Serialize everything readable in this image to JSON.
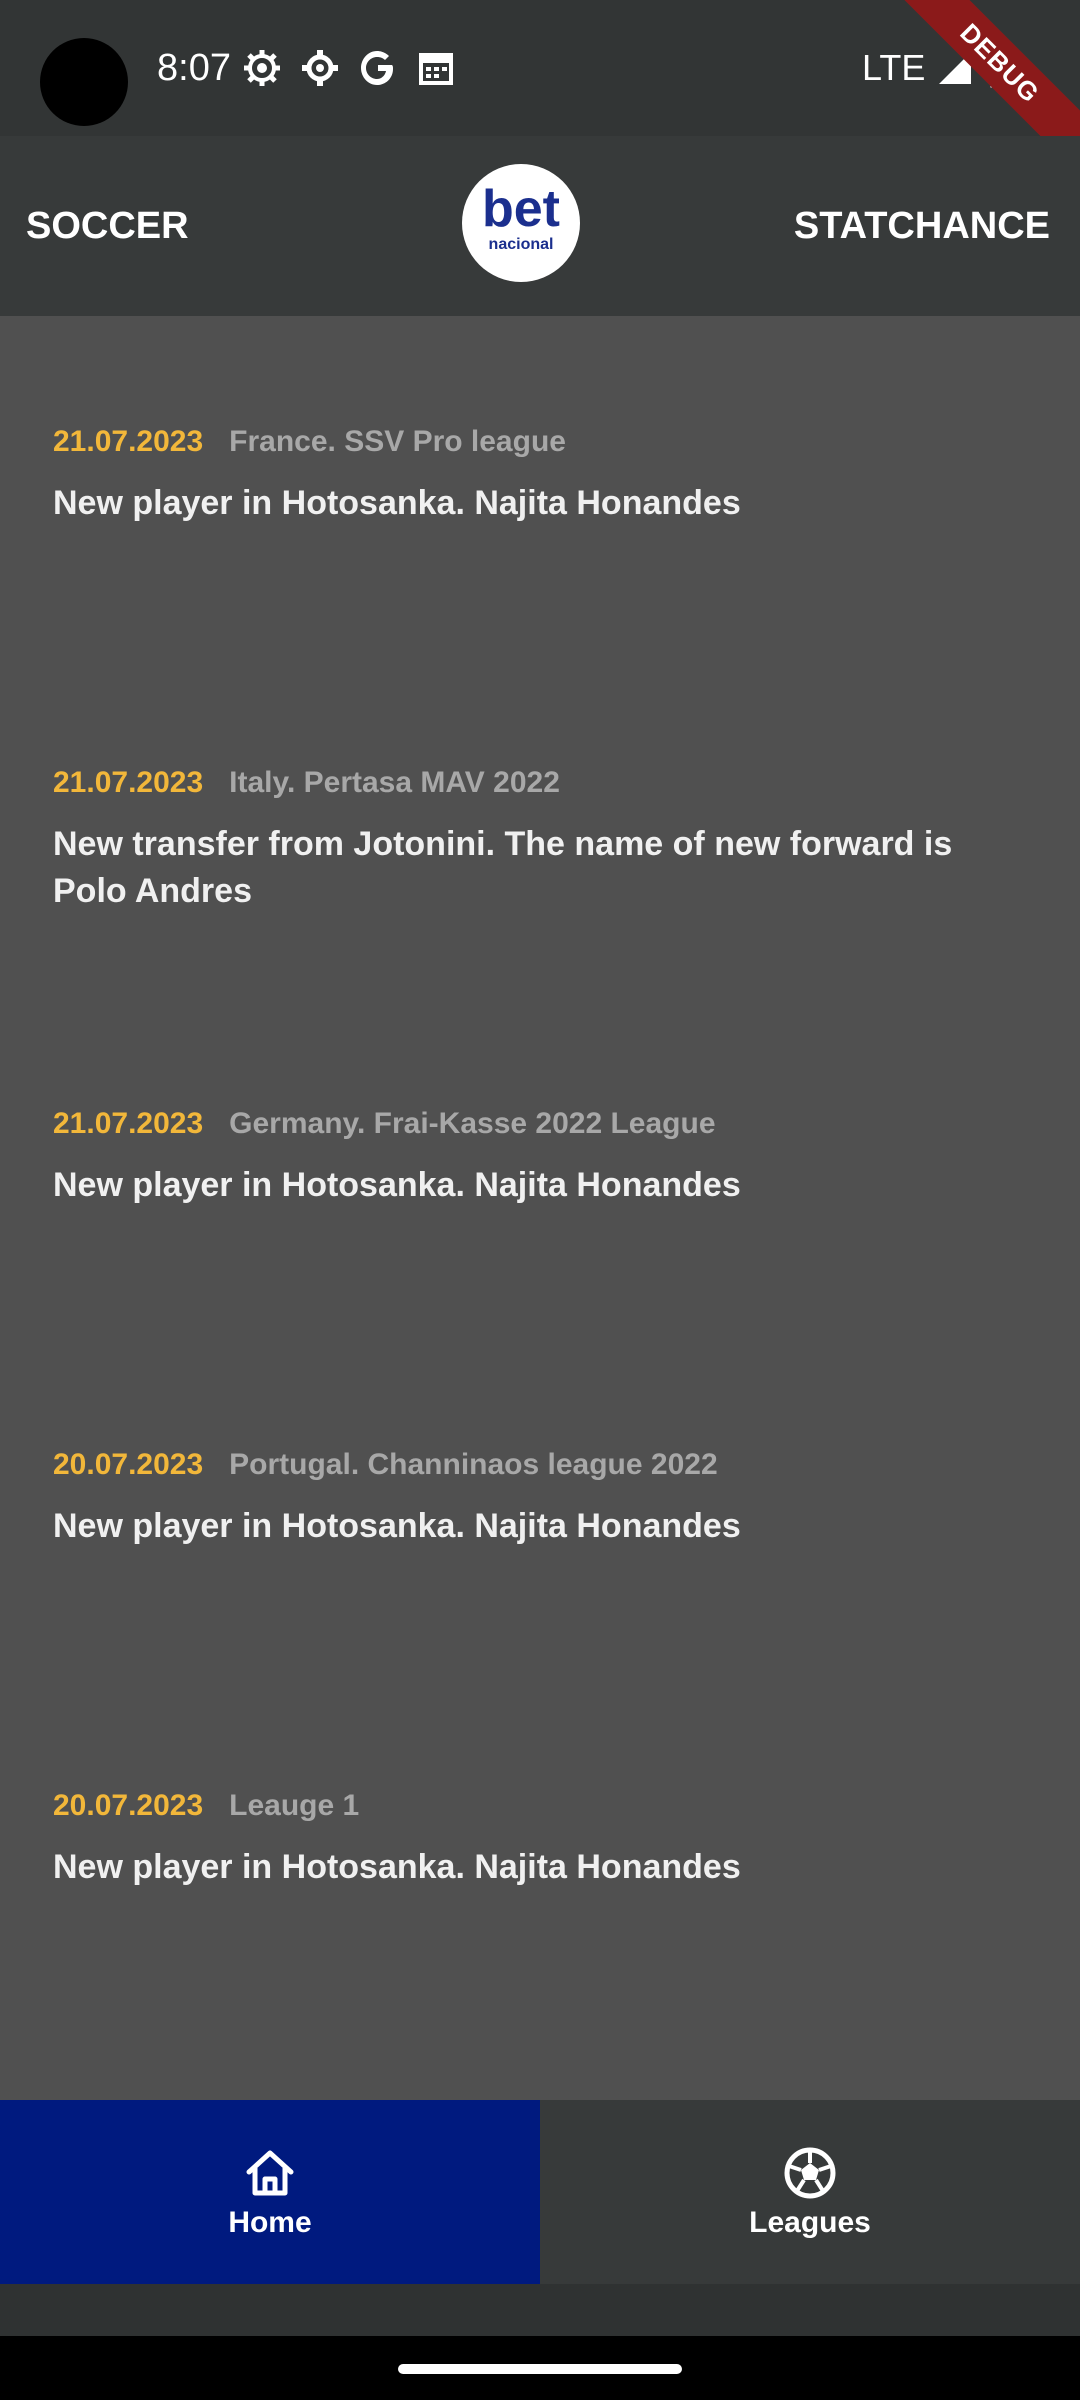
{
  "status_bar": {
    "time": "8:07",
    "network": "LTE",
    "icons": [
      "gear-icon",
      "settings-icon",
      "google-icon",
      "calendar-icon",
      "signal-icon",
      "battery-icon"
    ]
  },
  "debug_banner": "DEBUG",
  "app_bar": {
    "left_title": "SOCCER",
    "right_title": "STATCHANCE",
    "logo_word": "bet",
    "logo_sub": "nacional"
  },
  "news": [
    {
      "date": "21.07.2023",
      "league": "France. SSV Pro league",
      "title": "New player in Hotosanka. Najita Honandes"
    },
    {
      "date": "21.07.2023",
      "league": "Italy. Pertasa MAV 2022",
      "title": "New transfer from Jotonini. The name of new forward is Polo Andres"
    },
    {
      "date": "21.07.2023",
      "league": "Germany. Frai-Kasse 2022 League",
      "title": "New player in Hotosanka. Najita Honandes"
    },
    {
      "date": "20.07.2023",
      "league": "Portugal. Channinaos league 2022",
      "title": "New player in Hotosanka. Najita Honandes"
    },
    {
      "date": "20.07.2023",
      "league": "Leauge 1",
      "title": "New player in Hotosanka. Najita Honandes"
    }
  ],
  "bottom_nav": {
    "home_label": "Home",
    "leagues_label": "Leagues",
    "active": "Home"
  },
  "colors": {
    "accent_date": "#f2b73a",
    "nav_active_bg": "#001a7f",
    "content_bg": "#505050",
    "logo_blue": "#1b2f8e"
  }
}
